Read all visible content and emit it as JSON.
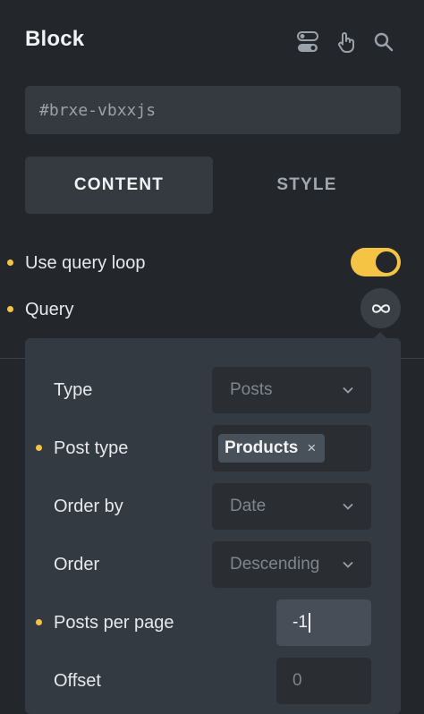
{
  "header": {
    "title": "Block",
    "icons": [
      "toggle-panel-icon",
      "pointer-hand-icon",
      "search-icon"
    ]
  },
  "element_id": "#brxe-vbxxjs",
  "tabs": [
    {
      "label": "CONTENT",
      "active": true
    },
    {
      "label": "STYLE",
      "active": false
    }
  ],
  "controls": {
    "use_query_loop": {
      "label": "Use query loop",
      "enabled": true
    },
    "query": {
      "label": "Query",
      "icon": "infinity-icon"
    }
  },
  "query_popup": {
    "type": {
      "label": "Type",
      "value": "Posts"
    },
    "post_type": {
      "label": "Post type",
      "tag": "Products",
      "remove_glyph": "×"
    },
    "order_by": {
      "label": "Order by",
      "value": "Date"
    },
    "order": {
      "label": "Order",
      "value": "Descending"
    },
    "posts_per_page": {
      "label": "Posts per page",
      "value": "-1"
    },
    "offset": {
      "label": "Offset",
      "placeholder": "0"
    }
  },
  "colors": {
    "accent": "#f5c445",
    "panel_bg": "#23272c",
    "popup_bg": "#343a41"
  }
}
